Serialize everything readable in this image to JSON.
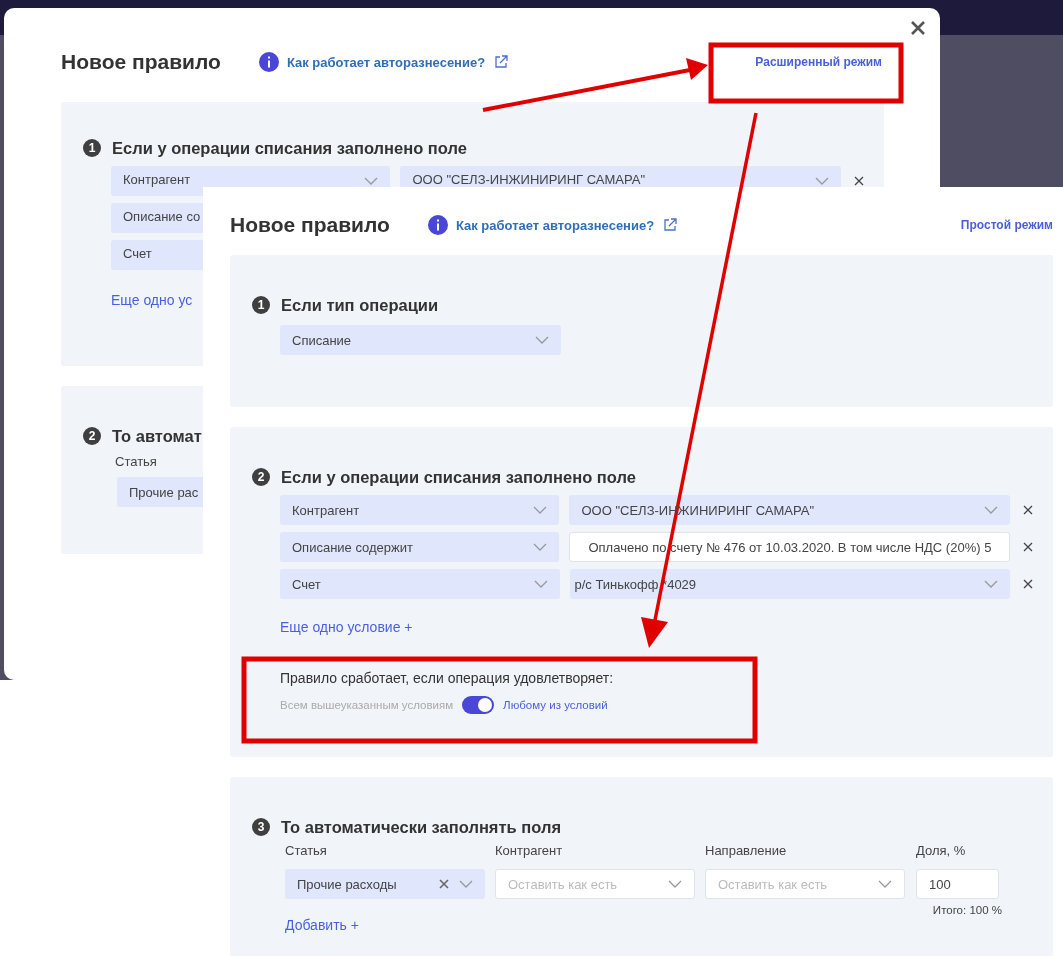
{
  "back_dialog": {
    "title": "Новое правило",
    "help_link": "Как работает авторазнесение?",
    "mode_link": "Расширенный режим",
    "condition_section": {
      "number": "1",
      "heading": "Если у операции списания заполнено поле",
      "conditions": [
        {
          "field": "Контрагент",
          "value": "ООО \"СЕЛЗ-ИНЖИНИРИНГ САМАРА\""
        },
        {
          "field": "Описание со"
        },
        {
          "field": "Счет"
        }
      ],
      "add_link": "Еще одно ус"
    },
    "fill_section": {
      "number": "2",
      "heading": "То автомат",
      "label": "Статья",
      "value": "Прочие рас"
    }
  },
  "front_dialog": {
    "title": "Новое правило",
    "help_link": "Как работает авторазнесение?",
    "mode_link": "Простой режим",
    "type_section": {
      "number": "1",
      "heading": "Если тип операции",
      "value": "Списание"
    },
    "condition_section": {
      "number": "2",
      "heading": "Если у операции списания заполнено поле",
      "conditions": [
        {
          "kind": "select",
          "field": "Контрагент",
          "value": "ООО \"СЕЛЗ-ИНЖИНИРИНГ САМАРА\""
        },
        {
          "kind": "text",
          "field": "Описание содержит",
          "value": "Оплачено по счету № 476 от 10.03.2020. В том числе НДС (20%) 5"
        },
        {
          "kind": "select",
          "field": "Счет",
          "value": "р/с Тинькофф *4029"
        }
      ],
      "add_link": "Еще одно условие +",
      "match_label": "Правило сработает, если операция удовлетворяет:",
      "match_all": "Всем вышеуказанным условиям",
      "match_any": "Любому из условий",
      "match_any_on": true
    },
    "fill_section": {
      "number": "3",
      "heading": "То автоматически заполнять поля",
      "columns": [
        {
          "kind": "select",
          "label": "Статья",
          "value": "Прочие расходы"
        },
        {
          "kind": "select",
          "label": "Контрагент",
          "placeholder": "Оставить как есть"
        },
        {
          "kind": "select",
          "label": "Направление",
          "placeholder": "Оставить как есть"
        },
        {
          "kind": "input",
          "label": "Доля, %",
          "value": "100",
          "note": "Итого: 100 %"
        }
      ],
      "add_link": "Добавить +"
    }
  }
}
